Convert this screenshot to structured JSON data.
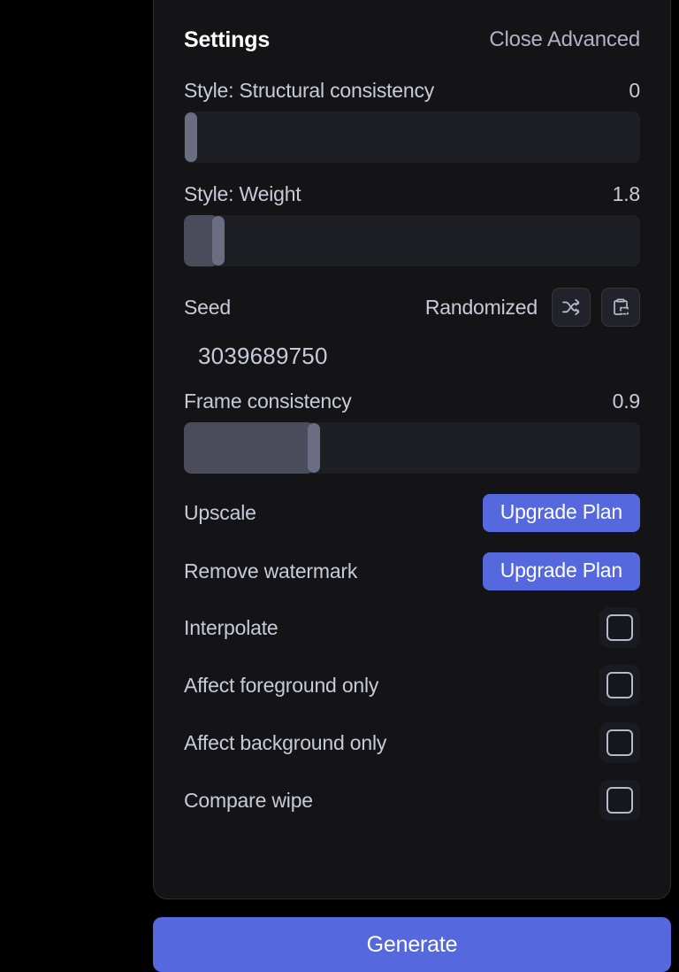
{
  "panel": {
    "title": "Settings",
    "close_label": "Close Advanced"
  },
  "sliders": [
    {
      "label": "Style: Structural consistency",
      "value": "0",
      "fill_percent": 0,
      "thumb_percent": 0
    },
    {
      "label": "Style: Weight",
      "value": "1.8",
      "fill_percent": 7.5,
      "thumb_percent": 7.5
    },
    {
      "label": "Frame consistency",
      "value": "0.9",
      "fill_percent": 28.5,
      "thumb_percent": 28.5
    }
  ],
  "seed": {
    "label": "Seed",
    "state": "Randomized",
    "value": "3039689750",
    "shuffle_icon": "shuffle-icon",
    "paste_icon": "clipboard-paste-icon"
  },
  "upgrade_rows": [
    {
      "label": "Upscale",
      "button": "Upgrade Plan"
    },
    {
      "label": "Remove watermark",
      "button": "Upgrade Plan"
    }
  ],
  "checkboxes": [
    {
      "label": "Interpolate",
      "checked": false
    },
    {
      "label": "Affect foreground only",
      "checked": false
    },
    {
      "label": "Affect background only",
      "checked": false
    },
    {
      "label": "Compare wipe",
      "checked": false
    }
  ],
  "footer": {
    "generate_label": "Generate"
  },
  "colors": {
    "accent": "#5568dd",
    "panel_bg": "#141416",
    "page_bg": "#000000",
    "text_primary": "#ffffff",
    "text_secondary": "#c7cbd9",
    "slider_track": "#1e1f24",
    "slider_fill": "#4a4c5b",
    "slider_thumb": "#6b6e82"
  }
}
